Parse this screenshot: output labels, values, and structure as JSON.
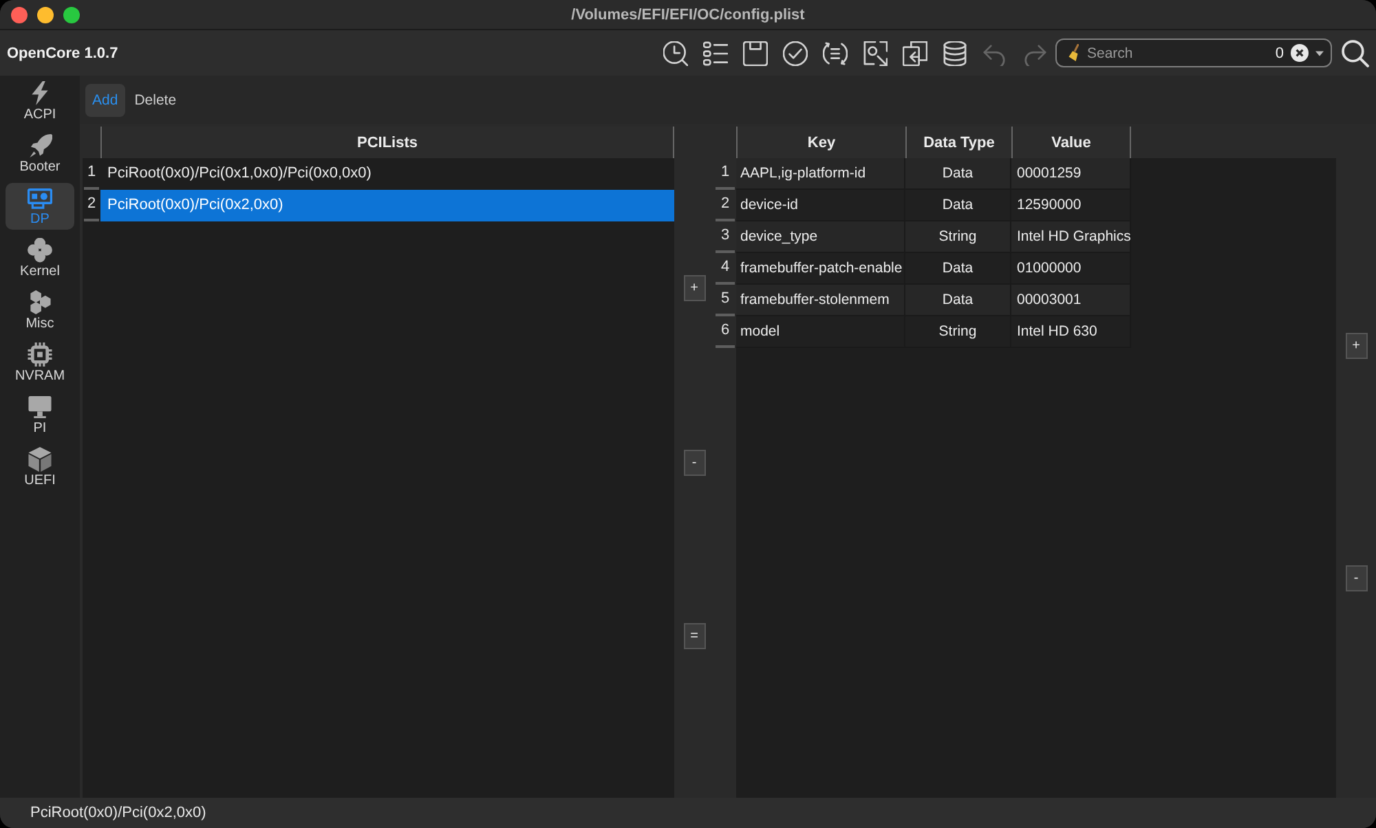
{
  "window": {
    "title": "/Volumes/EFI/EFI/OC/config.plist"
  },
  "toolbar": {
    "app_name": "OpenCore 1.0.7",
    "tools": [
      {
        "kind": "history",
        "disabled": false
      },
      {
        "kind": "list",
        "disabled": false
      },
      {
        "kind": "save",
        "disabled": false
      },
      {
        "kind": "check",
        "disabled": false
      },
      {
        "kind": "outline",
        "disabled": false
      },
      {
        "kind": "image",
        "disabled": false
      },
      {
        "kind": "copy",
        "disabled": false
      },
      {
        "kind": "database",
        "disabled": false
      },
      {
        "kind": "undo",
        "disabled": true
      },
      {
        "kind": "redo",
        "disabled": true
      }
    ],
    "search": {
      "placeholder": "Search",
      "count": "0"
    }
  },
  "sidebar": {
    "items": [
      {
        "label": "ACPI",
        "kind": "bolt",
        "selected": false
      },
      {
        "label": "Booter",
        "kind": "rocket",
        "selected": false
      },
      {
        "label": "DP",
        "kind": "card",
        "selected": true
      },
      {
        "label": "Kernel",
        "kind": "clover",
        "selected": false
      },
      {
        "label": "Misc",
        "kind": "hexagons",
        "selected": false
      },
      {
        "label": "NVRAM",
        "kind": "chip",
        "selected": false
      },
      {
        "label": "PI",
        "kind": "monitor",
        "selected": false
      },
      {
        "label": "UEFI",
        "kind": "cube",
        "selected": false
      }
    ]
  },
  "actions": [
    {
      "label": "Add",
      "selected": true
    },
    {
      "label": "Delete",
      "selected": false
    }
  ],
  "pci_table": {
    "columns": [
      "PCILists"
    ],
    "rows": [
      {
        "number": "1",
        "value": "PciRoot(0x0)/Pci(0x1,0x0)/Pci(0x0,0x0)",
        "selected": false
      },
      {
        "number": "2",
        "value": "PciRoot(0x0)/Pci(0x2,0x0)",
        "selected": true
      }
    ]
  },
  "list_buttons": [
    "+",
    "-",
    "="
  ],
  "properties_table": {
    "columns": [
      "Key",
      "Data Type",
      "Value"
    ],
    "rows": [
      {
        "number": "1",
        "cells": [
          "AAPL,ig-platform-id",
          "Data",
          "00001259"
        ]
      },
      {
        "number": "2",
        "cells": [
          "device-id",
          "Data",
          "12590000"
        ]
      },
      {
        "number": "3",
        "cells": [
          "device_type",
          "String",
          "Intel HD Graphics"
        ]
      },
      {
        "number": "4",
        "cells": [
          "framebuffer-patch-enable",
          "Data",
          "01000000"
        ]
      },
      {
        "number": "5",
        "cells": [
          "framebuffer-stolenmem",
          "Data",
          "00003001"
        ]
      },
      {
        "number": "6",
        "cells": [
          "model",
          "String",
          "Intel HD 630"
        ]
      }
    ]
  },
  "property_buttons": [
    "+",
    "-"
  ],
  "status_bar": {
    "text": "PciRoot(0x0)/Pci(0x2,0x0)"
  }
}
